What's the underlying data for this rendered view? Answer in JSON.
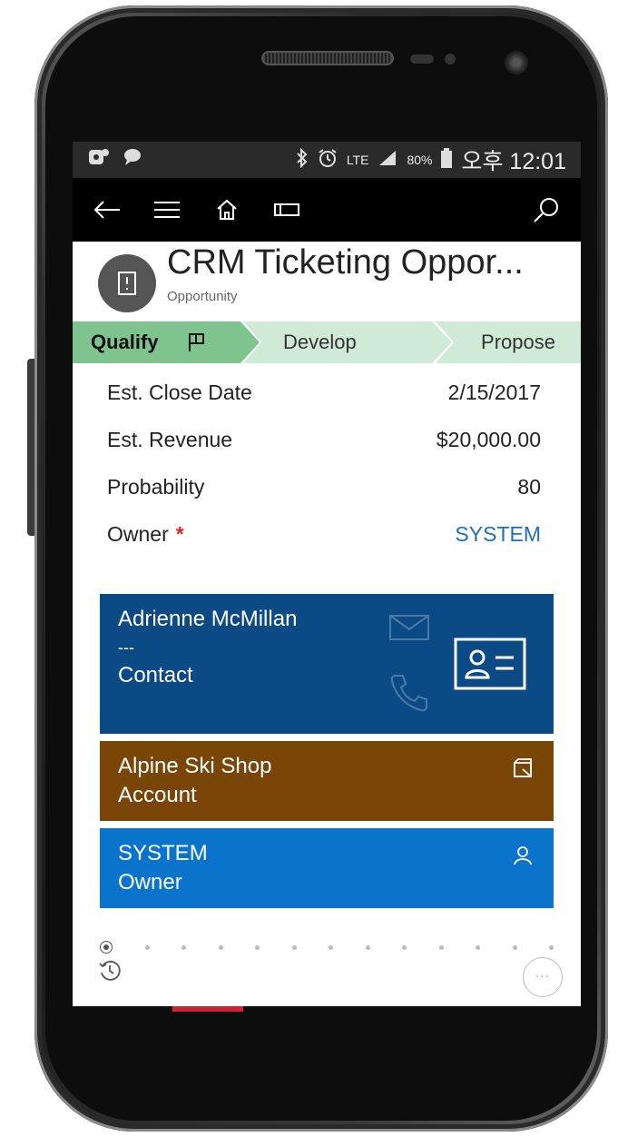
{
  "statusbar": {
    "lte": "LTE",
    "battery": "80%",
    "time": "오후 12:01"
  },
  "header": {
    "title": "CRM Ticketing Oppor...",
    "subtitle": "Opportunity"
  },
  "stages": [
    {
      "label": "Qualify",
      "active": true
    },
    {
      "label": "Develop",
      "active": false
    },
    {
      "label": "Propose",
      "active": false
    }
  ],
  "fields": [
    {
      "label": "Est. Close Date",
      "value": "2/15/2017"
    },
    {
      "label": "Est. Revenue",
      "value": "$20,000.00"
    },
    {
      "label": "Probability",
      "value": "80"
    },
    {
      "label": "Owner",
      "value": "SYSTEM",
      "required": true
    }
  ],
  "cards": {
    "contact": {
      "name": "Adrienne McMillan",
      "line2": "---",
      "type": "Contact",
      "color": "#0b4a85"
    },
    "account": {
      "name": "Alpine Ski Shop",
      "type": "Account",
      "color": "#7a4607"
    },
    "owner": {
      "name": "SYSTEM",
      "type": "Owner",
      "color": "#0a73cc"
    }
  },
  "more": {
    "label": "···"
  },
  "colors": {
    "stage_active": "#7fc48f",
    "stage_inactive": "#cfead7",
    "link": "#1a6fc2",
    "required": "#d6262b"
  }
}
